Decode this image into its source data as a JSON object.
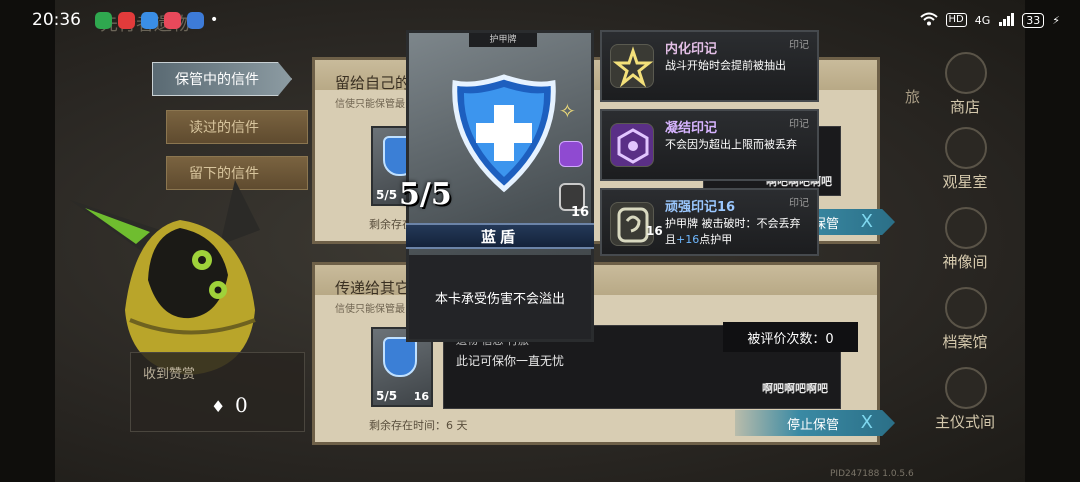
{
  "status_bar": {
    "time": "20:36",
    "app_icons": [
      {
        "name": "app-green-icon",
        "color": "#2fa84f"
      },
      {
        "name": "app-red-icon",
        "color": "#e23b3b"
      },
      {
        "name": "app-blue-icon",
        "color": "#3a8ee6"
      },
      {
        "name": "app-music-icon",
        "color": "#e8495b"
      },
      {
        "name": "app-translate-icon",
        "color": "#3d7bd8"
      }
    ],
    "network": "4G",
    "battery": "33"
  },
  "scene_title": "先行者遗物",
  "tabs": [
    {
      "label": "保管中的信件",
      "active": true
    },
    {
      "label": "读过的信件",
      "active": false
    },
    {
      "label": "留下的信件",
      "active": false
    }
  ],
  "reward": {
    "label": "收到赞赏",
    "value": "0"
  },
  "panel_top": {
    "title": "留给自己的",
    "subtitle": "信使只能保管最",
    "card_cost": "5/5",
    "remain": "剩余存在",
    "partial_text": "啊吧啊吧啊吧",
    "stop_label": "停止保管"
  },
  "panel_bottom": {
    "title": "传递给其它",
    "subtitle": "信使只能保管最",
    "card_cost": "5/5",
    "card_num": "16",
    "remain": "剩余存在时间：6 天",
    "message_partial": "遗物 信息 行旅",
    "message": "此记可保你一直无忧",
    "signature": "啊吧啊吧啊吧",
    "rating": "被评价次数：0",
    "stop_label": "停止保管"
  },
  "right_nav": [
    {
      "label": "商店",
      "icon": "shop-emblem-icon"
    },
    {
      "label": "观星室",
      "icon": "observatory-emblem-icon"
    },
    {
      "label": "神像间",
      "icon": "statue-emblem-icon"
    },
    {
      "label": "档案馆",
      "icon": "archive-emblem-icon"
    },
    {
      "label": "主仪式间",
      "icon": "ritual-emblem-icon"
    }
  ],
  "right_nav_partial": "旅",
  "card": {
    "type_label": "护甲牌",
    "cost": "5/5",
    "num": "16",
    "name": "蓝盾",
    "description": "本卡承受伤害不会溢出"
  },
  "sigils": [
    {
      "title": "内化印记",
      "tag": "印记",
      "desc": "战斗开始时会提前被抽出",
      "color": "#f3e07a"
    },
    {
      "title": "凝结印记",
      "tag": "印记",
      "desc": "不会因为超出上限而被丢弃",
      "color": "#a55ee0"
    },
    {
      "title": "顽强印记16",
      "tag": "印记",
      "desc_a": "护甲牌 被击破时：不会丢弃",
      "desc_b": "且",
      "desc_hl": "+16",
      "desc_c": "点护甲",
      "num": "16",
      "color": "#d9d9c0"
    }
  ],
  "version": "PID247188 1.0.5.6"
}
